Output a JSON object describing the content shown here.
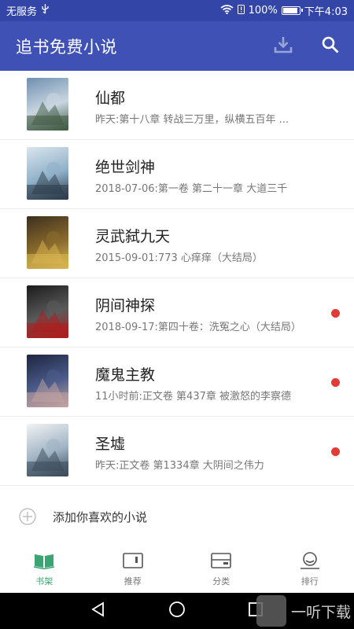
{
  "status_bar": {
    "carrier": "无服务",
    "battery": "100%",
    "battery_level": 1.0,
    "time": "下午4:03"
  },
  "app_bar": {
    "title": "追书免费小说",
    "download_icon": "download-icon",
    "search_icon": "search-icon"
  },
  "books": [
    {
      "title": "仙都",
      "chapter": "昨天:第十八章 转战三万里，纵横五百年 ...",
      "unread": false,
      "cover_colors": [
        "#6d8fb0",
        "#c9d6e0",
        "#3f5a42"
      ]
    },
    {
      "title": "绝世剑神",
      "chapter": "2018-07-06:第一卷 第二十一章 大道三千",
      "unread": false,
      "cover_colors": [
        "#d9e6ef",
        "#8fb0c8",
        "#2b3b4a"
      ]
    },
    {
      "title": "灵武弑九天",
      "chapter": "2015-09-01:773 心痒痒（大结局）",
      "unread": false,
      "cover_colors": [
        "#3b2f1e",
        "#8a6a2c",
        "#d9b650"
      ]
    },
    {
      "title": "阴间神探",
      "chapter": "2018-09-17:第四十卷：洗冤之心（大结局）",
      "unread": true,
      "cover_colors": [
        "#1b1b1b",
        "#5a5a5a",
        "#b01c1c"
      ]
    },
    {
      "title": "魔鬼主教",
      "chapter": "11小时前:正文卷 第437章 被激怒的李察德",
      "unread": true,
      "cover_colors": [
        "#1d2540",
        "#4b5c8a",
        "#c3a3a0"
      ]
    },
    {
      "title": "圣墟",
      "chapter": "昨天:正文卷 第1334章 大阴间之伟力",
      "unread": true,
      "cover_colors": [
        "#f2f2f2",
        "#9fb4c4",
        "#3a4a5a"
      ]
    }
  ],
  "add_novel": {
    "label": "添加你喜欢的小说"
  },
  "bottom_nav": [
    {
      "label": "书架",
      "icon": "bookshelf-icon",
      "active": true
    },
    {
      "label": "推荐",
      "icon": "recommend-icon",
      "active": false
    },
    {
      "label": "分类",
      "icon": "category-icon",
      "active": false
    },
    {
      "label": "排行",
      "icon": "ranking-icon",
      "active": false
    }
  ],
  "watermark": "一听下载",
  "colors": {
    "status_bar": "#3346a8",
    "app_bar": "#3f51b5",
    "active_tab": "#3aa572",
    "unread_dot": "#e53935"
  }
}
